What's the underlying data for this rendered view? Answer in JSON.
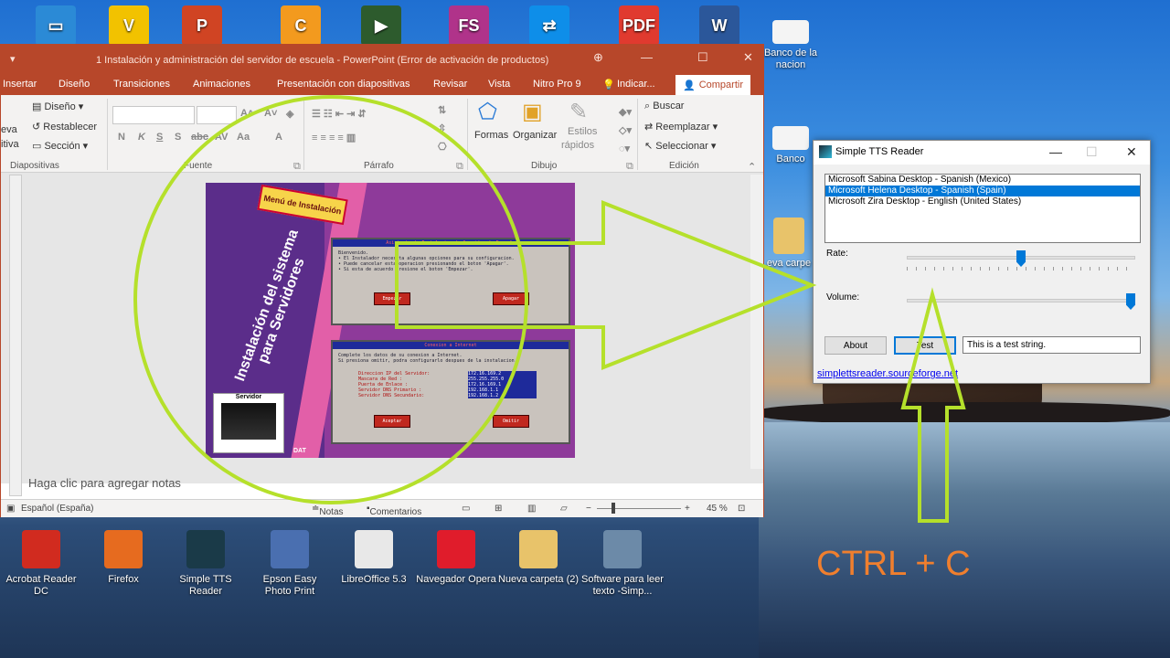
{
  "desktop_top_icons": [
    {
      "name": "this-pc-icon",
      "color": "#2b8ad6",
      "glyph": "▭"
    },
    {
      "name": "veeam-icon",
      "color": "#f2c200",
      "glyph": "V"
    },
    {
      "name": "powerpoint-icon",
      "color": "#d04423",
      "glyph": "P"
    },
    {
      "name": "ccleaner-icon",
      "color": "#f39a1e",
      "glyph": "C"
    },
    {
      "name": "camtasia-icon",
      "color": "#2d5b2d",
      "glyph": "▶"
    },
    {
      "name": "faststone-icon",
      "color": "#b0338a",
      "glyph": "FS"
    },
    {
      "name": "teamviewer-icon",
      "color": "#0e8ee9",
      "glyph": "⇄"
    },
    {
      "name": "pdf-icon",
      "color": "#e03a2f",
      "glyph": "PDF"
    },
    {
      "name": "word-icon",
      "color": "#2b579a",
      "glyph": "W"
    }
  ],
  "desktop_right_icons": [
    {
      "label": "Banco de la nacion"
    },
    {
      "label": "Banco"
    },
    {
      "label": "eva carpe"
    }
  ],
  "powerpoint": {
    "title": "1 Instalación y administración del servidor de escuela - PowerPoint (Error de activación de productos)",
    "menu": [
      "Insertar",
      "Diseño",
      "Transiciones",
      "Animaciones",
      "Presentación con diapositivas",
      "Revisar",
      "Vista",
      "Nitro Pro 9",
      "Indicar..."
    ],
    "share": "Compartir",
    "ribbon": {
      "diseno": "Diseño",
      "restablecer": "Restablecer",
      "seccion": "Sección",
      "nueva1": "eva",
      "nueva2": "itiva",
      "group_diapositivas": "Diapositivas",
      "group_fuente": "Fuente",
      "group_parrafo": "Párrafo",
      "group_dibujo": "Dibujo",
      "group_edicion": "Edición",
      "formas": "Formas",
      "organizar": "Organizar",
      "estilos1": "Estilos",
      "estilos2": "rápidos",
      "buscar": "Buscar",
      "reemplazar": "Reemplazar",
      "seleccionar": "Seleccionar",
      "font_buttons": [
        "N",
        "K",
        "S",
        "S",
        "abc",
        "AV",
        "Aa",
        "A"
      ]
    },
    "slide": {
      "menu_tag": "Menú de Instalación",
      "vertical_title": "Instalación del sistema para Servidores",
      "panel1_header": "Asistente de Instalacion de Servidor de Escuela",
      "panel1_lines": [
        "Bienvenido.",
        "• El Instalador necesita algunas opciones para su configuracion.",
        "• Puede cancelar esta operacion presionando el boton 'Apagar'.",
        "• Si esta de acuerdo presione el boton 'Empezar'."
      ],
      "btn_empezar": "Empezar",
      "btn_apagar": "Apagar",
      "panel2_header": "Conexion a Internet",
      "panel2_lines": [
        "Complete los datos de su conexion a Internet.",
        "Si presiona omitir, podra configurarlo despues de la instalacion."
      ],
      "fields": [
        {
          "label": "Direccion IP del Servidor:",
          "value": "172.16.169.2"
        },
        {
          "label": "Mascara de Red        :",
          "value": "255.255.255.0"
        },
        {
          "label": "Puerta de Enlace      :",
          "value": "172.16.169.1"
        },
        {
          "label": "Servidor DNS Primario :",
          "value": "192.168.1.1"
        },
        {
          "label": "Servidor DNS Secundario:",
          "value": "192.168.1.2"
        }
      ],
      "btn_aceptar": "Aceptar",
      "btn_omitir": "Omitir",
      "server_label": "Servidor",
      "dat": "DAT"
    },
    "notes_placeholder": "Haga clic para agregar notas",
    "status": {
      "language": "Español (España)",
      "notas": "Notas",
      "comentarios": "Comentarios",
      "zoom": "45 %"
    }
  },
  "tts": {
    "title": "Simple TTS Reader",
    "voices": [
      {
        "label": "Microsoft Sabina Desktop - Spanish (Mexico)",
        "selected": false
      },
      {
        "label": "Microsoft Helena Desktop - Spanish (Spain)",
        "selected": true
      },
      {
        "label": "Microsoft Zira Desktop - English (United States)",
        "selected": false
      }
    ],
    "rate_label": "Rate:",
    "rate_value": 0.5,
    "volume_label": "Volume:",
    "volume_value": 1.0,
    "about": "About",
    "test": "Test",
    "text_value": "This is a test string.",
    "link": "simplettsreader.sourceforge.net"
  },
  "desktop_bottom_icons": [
    {
      "label": "Acrobat Reader DC",
      "color": "#d12b1f"
    },
    {
      "label": "Firefox",
      "color": "#e66b1f"
    },
    {
      "label": "Simple TTS Reader",
      "color": "#1a3a48"
    },
    {
      "label": "Epson Easy Photo Print",
      "color": "#4a6fb0"
    },
    {
      "label": "LibreOffice 5.3",
      "color": "#e8e8e8"
    },
    {
      "label": "Navegador Opera",
      "color": "#e01c2b"
    },
    {
      "label": "Nueva carpeta (2)",
      "color": "#e8c36a"
    },
    {
      "label": "Software para leer texto -Simp...",
      "color": "#6c8aa8"
    }
  ],
  "overlay_text": "CTRL + C",
  "annotation_color": "#b5e02b"
}
